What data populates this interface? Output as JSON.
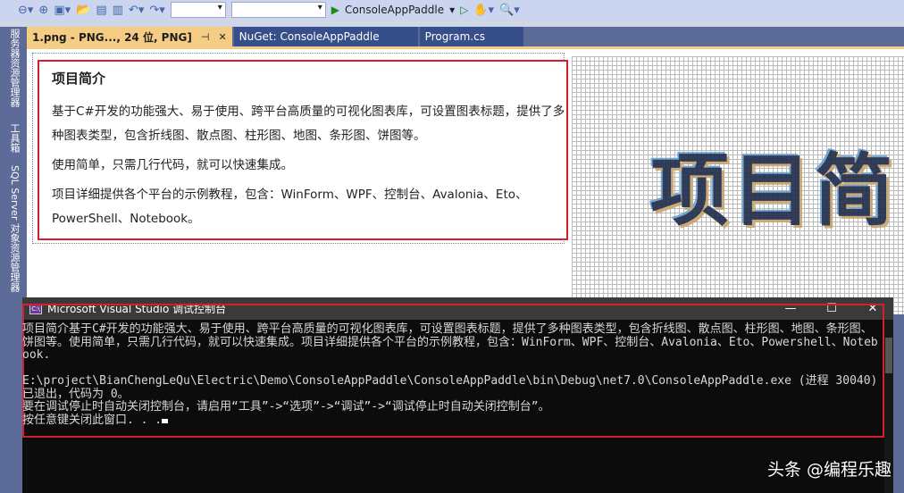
{
  "toolbar": {
    "startup_project": "ConsoleAppPaddle"
  },
  "sidebar": {
    "tabs": [
      "服务器资源管理器",
      "工具箱",
      "SQL Server 对象资源管理器"
    ]
  },
  "tabs": [
    {
      "label": "1.png - PNG..., 24 位, PNG]",
      "active": true
    },
    {
      "label": "NuGet: ConsoleAppPaddle"
    },
    {
      "label": "Program.cs"
    }
  ],
  "image": {
    "heading": "项目简介",
    "p1": "基于C#开发的功能强大、易于使用、跨平台高质量的可视化图表库，可设置图表标题，提供了多",
    "p1b": "种图表类型，包含折线图、散点图、柱形图、地图、条形图、饼图等。",
    "p2": "使用简单，只需几行代码，就可以快速集成。",
    "p3": "项目详细提供各个平台的示例教程，包含：WinForm、WPF、控制台、Avalonia、Eto、",
    "p3b": "PowerShell、Notebook。",
    "zoom_text": "项目简"
  },
  "console": {
    "title": "Microsoft Visual Studio 调试控制台",
    "output": "项目简介基于C#开发的功能强大、易于使用、跨平台高质量的可视化图表库，可设置图表标题，提供了多种图表类型，包含折线图、散点图、柱形图、地图、条形图、饼图等。使用简单，只需几行代码，就可以快速集成。项目详细提供各个平台的示例教程，包含：WinForm、WPF、控制台、Avalonia、Eto、Powershell、Notebook.\n\nE:\\project\\BianChengLeQu\\Electric\\Demo\\ConsoleAppPaddle\\ConsoleAppPaddle\\bin\\Debug\\net7.0\\ConsoleAppPaddle.exe (进程 30040)已退出，代码为 0。\n要在调试停止时自动关闭控制台，请启用“工具”->“选项”->“调试”->“调试停止时自动关闭控制台”。\n按任意键关闭此窗口. . ."
  },
  "watermark": "头条 @编程乐趣"
}
